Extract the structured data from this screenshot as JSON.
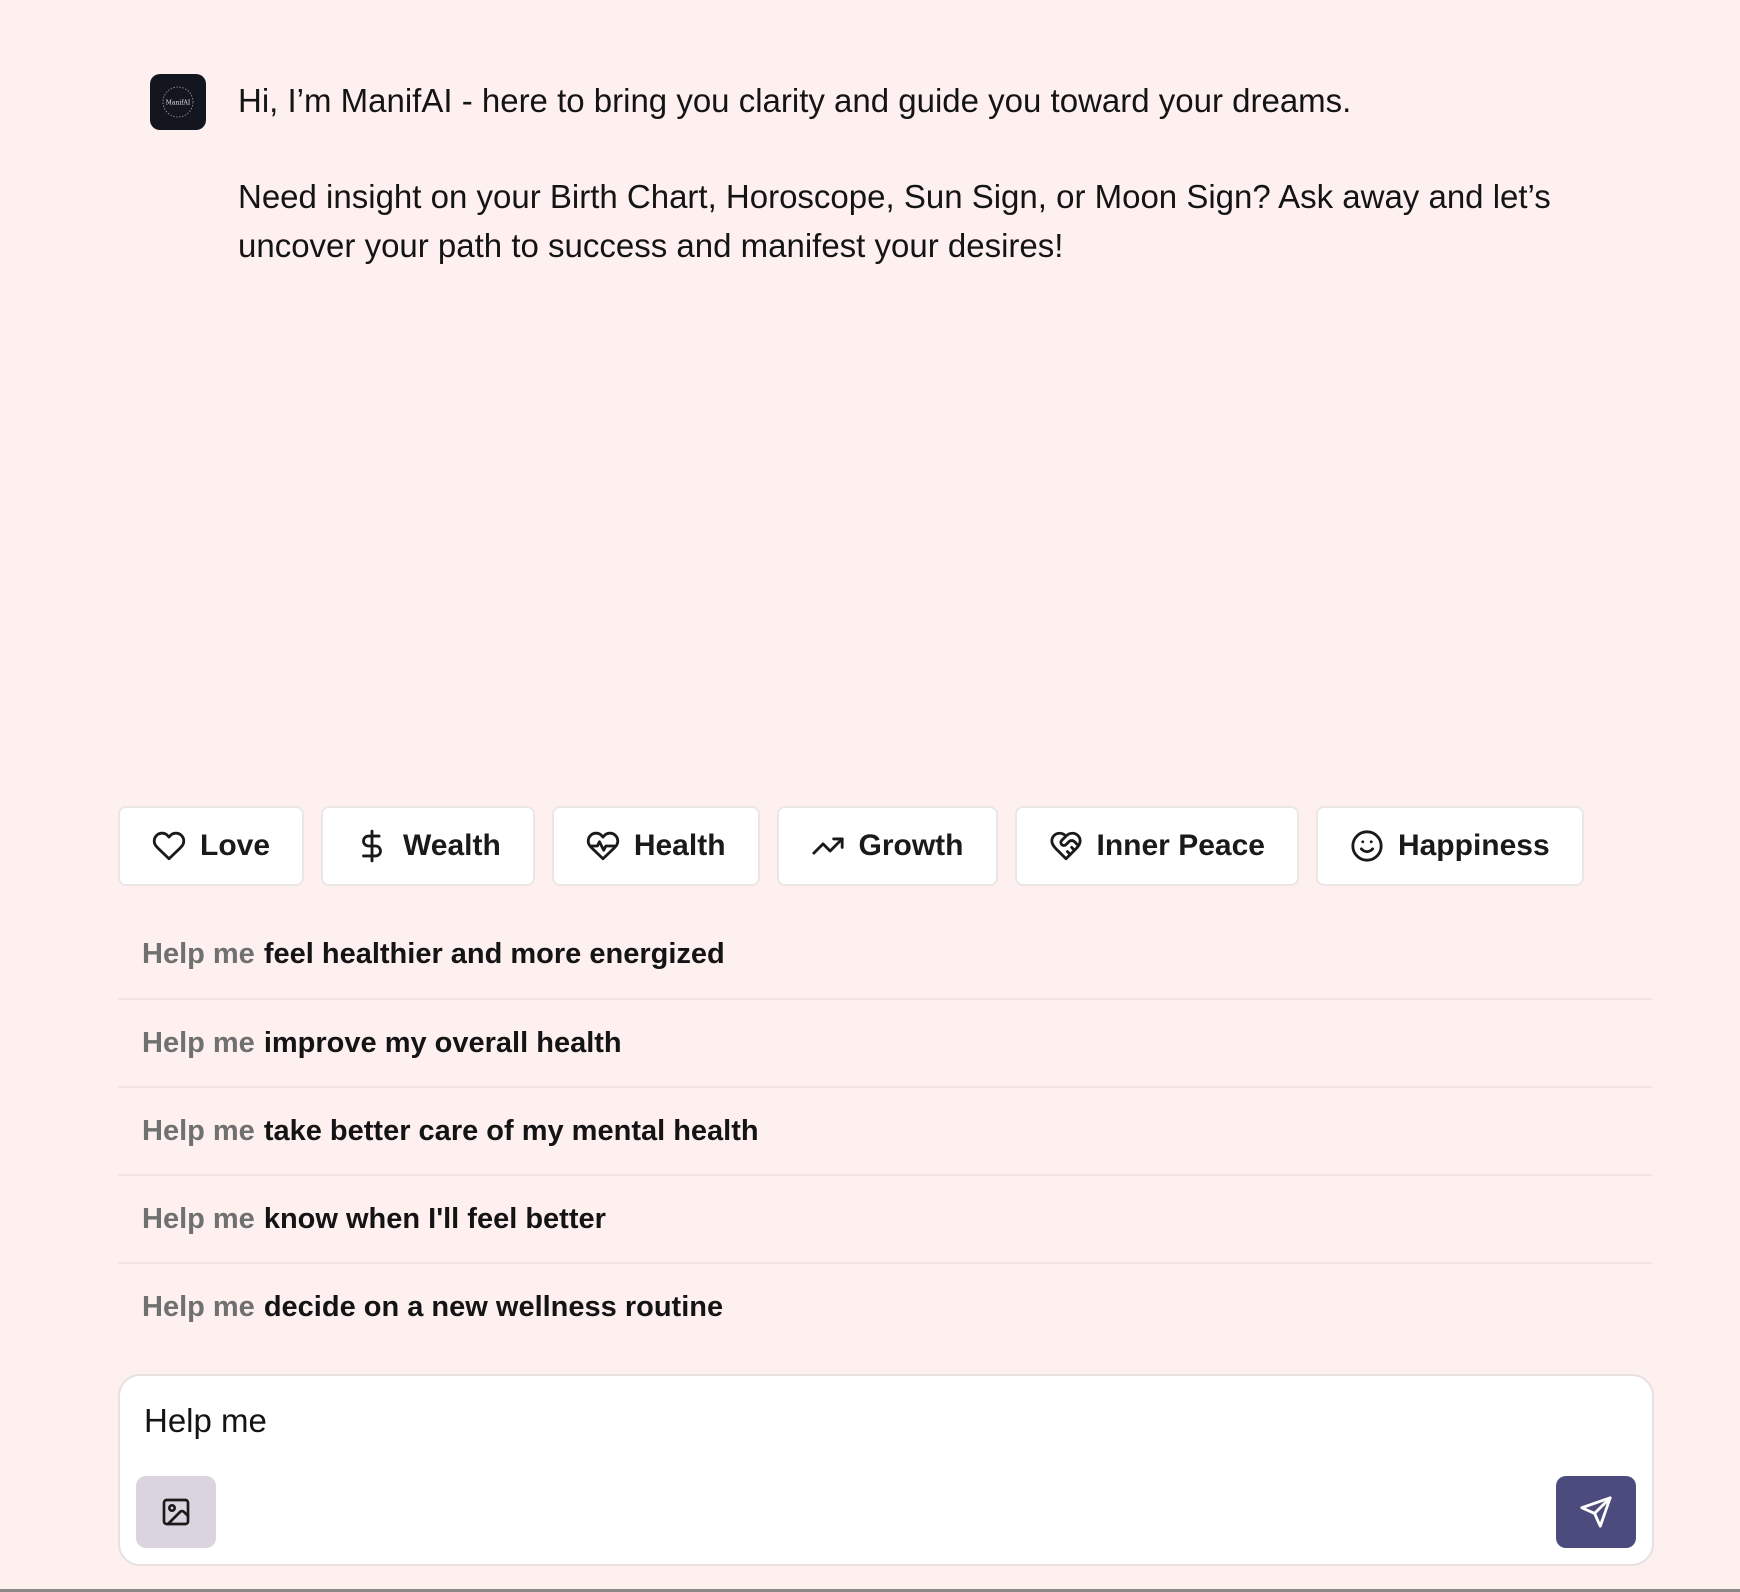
{
  "assistant": {
    "avatar_text": "ManifAI",
    "greeting": "Hi, I’m ManifAI - here to bring you clarity and guide you toward your dreams.",
    "prompt": "Need insight on your Birth Chart, Horoscope, Sun Sign, or Moon Sign? Ask away and let’s uncover your path to success and manifest your desires!"
  },
  "categories": [
    {
      "label": "Love",
      "icon": "heart-icon"
    },
    {
      "label": "Wealth",
      "icon": "dollar-icon"
    },
    {
      "label": "Health",
      "icon": "heart-pulse-icon"
    },
    {
      "label": "Growth",
      "icon": "trending-up-icon"
    },
    {
      "label": "Inner Peace",
      "icon": "heart-handshake-icon"
    },
    {
      "label": "Happiness",
      "icon": "smile-icon"
    }
  ],
  "suggestions": [
    {
      "prefix": "Help me",
      "text": "feel healthier and more energized"
    },
    {
      "prefix": "Help me",
      "text": "improve my overall health"
    },
    {
      "prefix": "Help me",
      "text": "take better care of my mental health"
    },
    {
      "prefix": "Help me",
      "text": "know when I'll feel better"
    },
    {
      "prefix": "Help me",
      "text": "decide on a new wellness routine"
    }
  ],
  "composer": {
    "value": "Help me",
    "image_button_icon": "image-icon",
    "send_button_icon": "send-icon"
  },
  "colors": {
    "background": "#fdf0ef",
    "send_button": "#4c4b7e",
    "image_button": "#d9d4e0",
    "avatar": "#14161f"
  }
}
